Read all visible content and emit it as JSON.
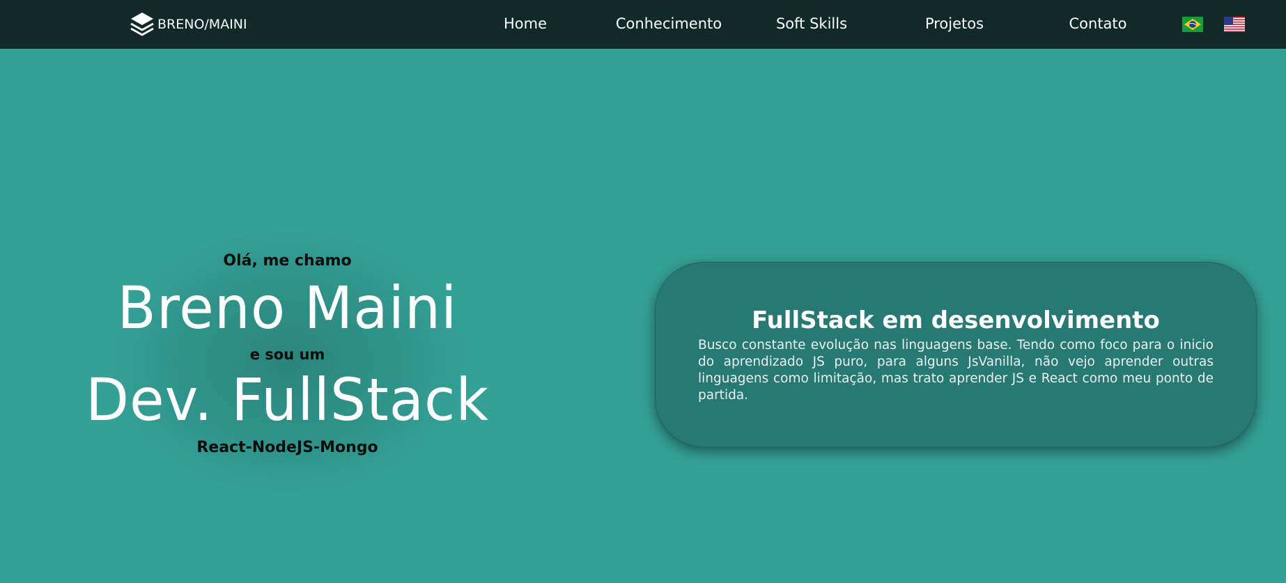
{
  "brand": {
    "text": "BRENO/MAINI",
    "icon": "layers-icon"
  },
  "nav": {
    "items": [
      {
        "label": "Home"
      },
      {
        "label": "Conhecimento"
      },
      {
        "label": "Soft Skills"
      },
      {
        "label": "Projetos"
      },
      {
        "label": "Contato"
      }
    ],
    "languages": [
      {
        "icon": "brazil-flag-icon"
      },
      {
        "icon": "usa-flag-icon"
      }
    ]
  },
  "hero": {
    "greeting": "Olá, me chamo",
    "name": "Breno Maini",
    "intro": "e sou um",
    "role": "Dev. FullStack",
    "stack": "React-NodeJS-Mongo"
  },
  "card": {
    "title": "FullStack em desenvolvimento",
    "text": "Busco constante evolução nas linguagens base. Tendo como foco para o inicio do aprendizado JS puro, para alguns JsVanilla, não vejo aprender outras linguagens como limitação, mas trato aprender JS e React como meu ponto de partida."
  },
  "colors": {
    "background": "#34a096",
    "navbar": "#12292a",
    "card": "#287873"
  }
}
